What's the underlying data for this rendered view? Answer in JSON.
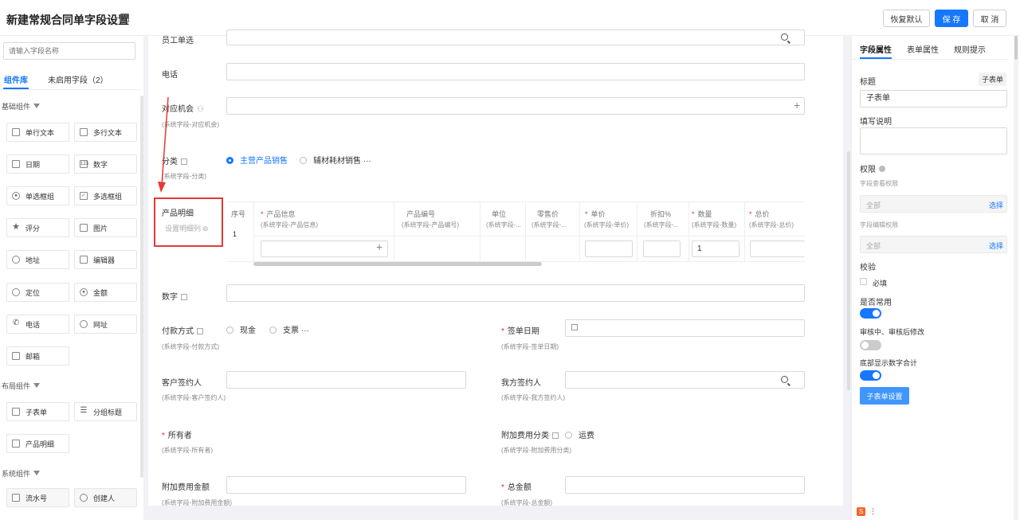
{
  "header": {
    "title": "新建常规合同单字段设置",
    "restore_label": "恢复默认",
    "save_label": "保 存",
    "cancel_label": "取 消"
  },
  "left": {
    "search_placeholder": "请输入字段名称",
    "tabs": [
      "组件库",
      "未启用字段（2）"
    ],
    "sections": {
      "basic": "基础组件",
      "layout": "布局组件",
      "system": "系统组件"
    },
    "basic_items": [
      "单行文本",
      "多行文本",
      "日期",
      "数字",
      "单选框组",
      "多选框组",
      "评分",
      "图片",
      "地址",
      "编辑器",
      "定位",
      "金额",
      "电话",
      "网址",
      "邮箱"
    ],
    "layout_items": [
      "子表单",
      "分组标题",
      "产品明细"
    ],
    "system_items": [
      "流水号",
      "创建人"
    ]
  },
  "form": {
    "employee_label": "员工单选",
    "phone_label": "电话",
    "opportunity_label": "对应机会",
    "opportunity_sub": "(系统字段-对应机会)",
    "category_label": "分类",
    "category_sub": "(系统字段-分类)",
    "category_opt1": "主营产品销售",
    "category_opt2": "辅材耗材销售",
    "product_label": "产品明细",
    "product_setting": "设置明细列",
    "table_headers": [
      {
        "t": "序号",
        "s": "",
        "req": false
      },
      {
        "t": "产品信息",
        "s": "(系统字段-产品信息)",
        "req": true
      },
      {
        "t": "产品编号",
        "s": "(系统字段-产品编号)",
        "req": false
      },
      {
        "t": "单位",
        "s": "(系统字段-...",
        "req": false
      },
      {
        "t": "零售价",
        "s": "(系统字段-...",
        "req": false
      },
      {
        "t": "单价",
        "s": "(系统字段-单价)",
        "req": true
      },
      {
        "t": "折扣%",
        "s": "(系统字段-...",
        "req": false
      },
      {
        "t": "数量",
        "s": "(系统字段-数量)",
        "req": true
      },
      {
        "t": "总价",
        "s": "(系统字段-总价)",
        "req": true
      }
    ],
    "row_index": "1",
    "qty_value": "1",
    "number_label": "数字",
    "payment_label": "付款方式",
    "payment_sub": "(系统字段-付款方式)",
    "payment_opt1": "现金",
    "payment_opt2": "支票",
    "sign_date_label": "签单日期",
    "sign_date_sub": "(系统字段-签单日期)",
    "customer_signer_label": "客户签约人",
    "customer_signer_sub": "(系统字段-客户签约人)",
    "our_signer_label": "我方签约人",
    "our_signer_sub": "(系统字段-我方签约人)",
    "owner_label": "所有者",
    "owner_sub": "(系统字段-所有者)",
    "extra_cat_label": "附加费用分类",
    "extra_cat_sub": "(系统字段-附加费用分类)",
    "extra_cat_opt": "运费",
    "extra_amt_label": "附加费用金额",
    "extra_amt_sub": "(系统字段-附加费用金额)",
    "total_label": "总金额",
    "total_sub": "(系统字段-总金额)"
  },
  "right": {
    "tabs": [
      "字段属性",
      "表单属性",
      "规则提示"
    ],
    "title_label": "标题",
    "title_tag": "子表单",
    "title_value": "子表单",
    "desc_label": "填写说明",
    "perm_label": "权限",
    "view_perm": "字段查看权限",
    "edit_perm": "字段编辑权限",
    "all": "全部",
    "choose": "选择",
    "validate_label": "校验",
    "required_label": "必填",
    "common_label": "是否常用",
    "review_label": "审核中、审核后修改",
    "bottom_sum_label": "底部显示数字合计",
    "subform_btn": "子表单设置"
  },
  "colors": {
    "accent": "#1677ff",
    "annotation": "#e53935"
  }
}
